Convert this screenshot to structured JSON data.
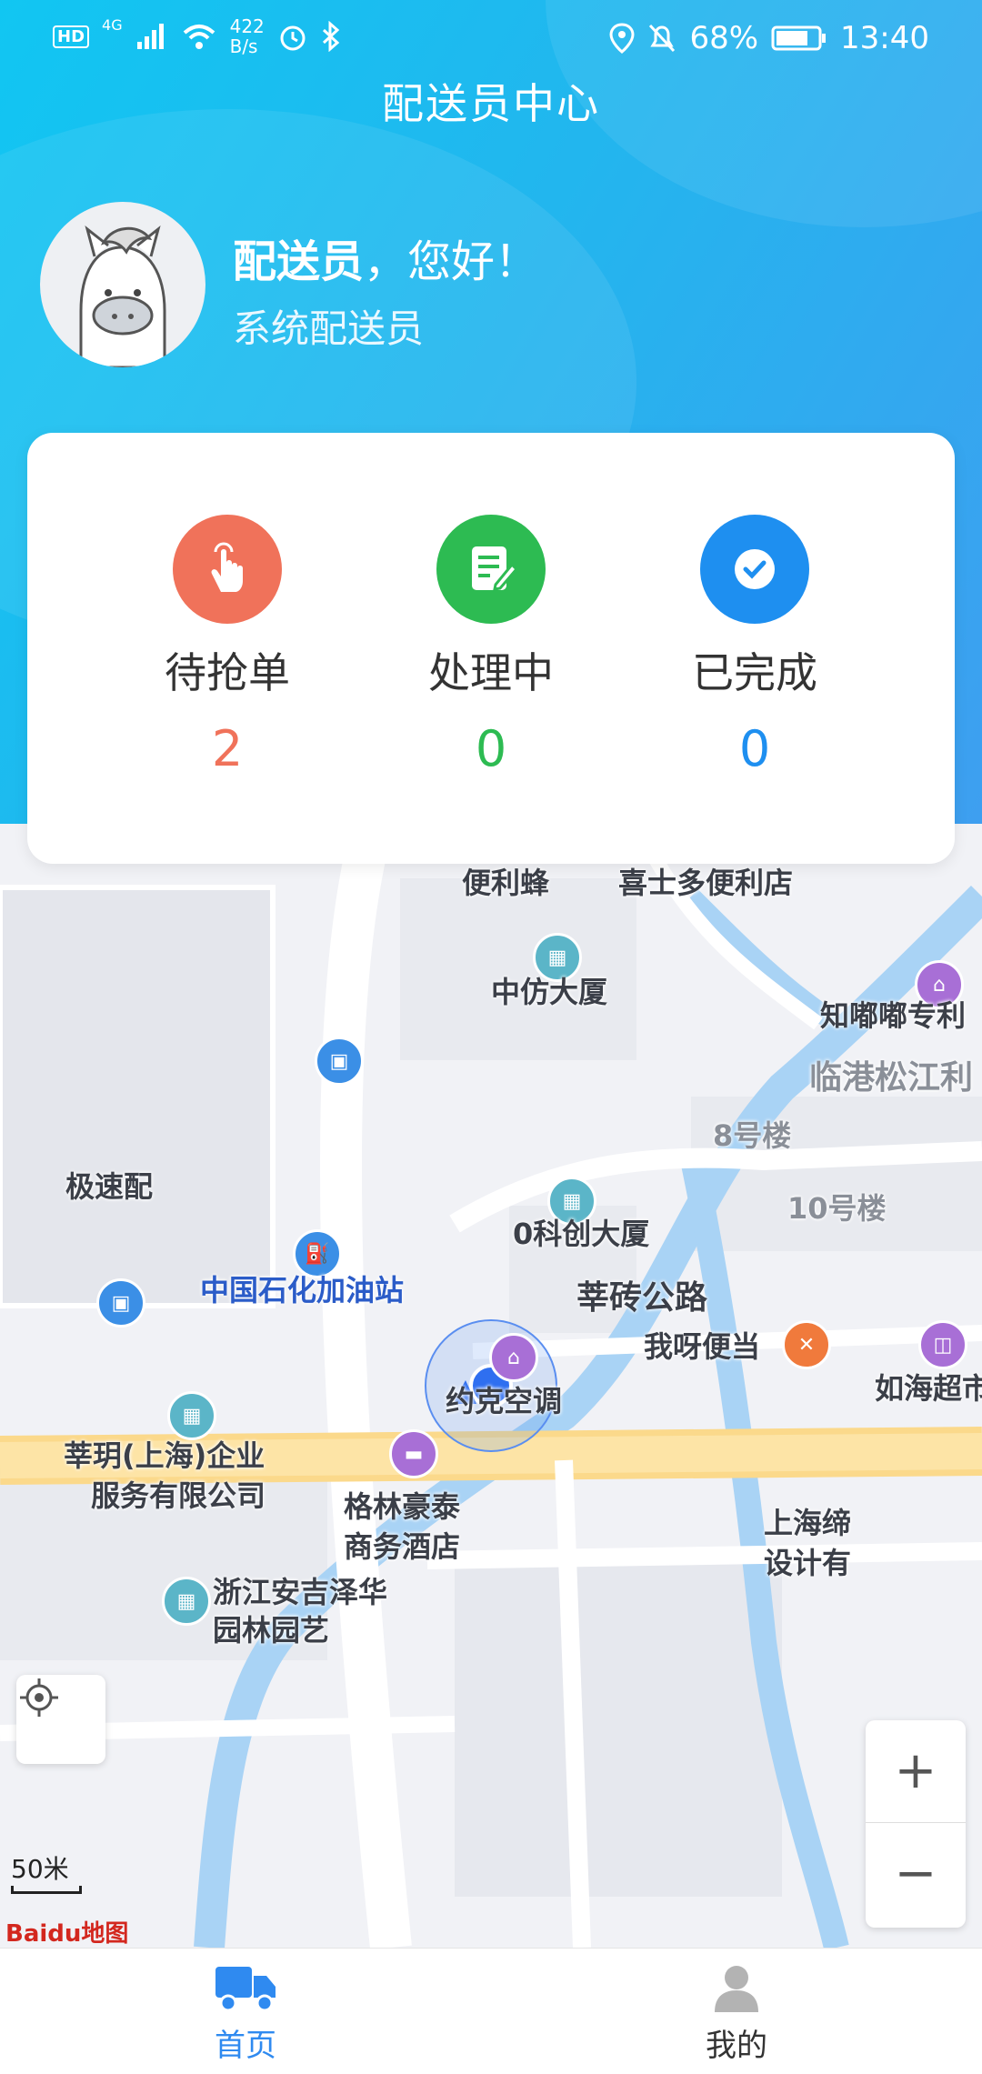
{
  "status_bar": {
    "hd": "HD",
    "network": "4G",
    "speed_value": "422",
    "speed_unit": "B/s",
    "battery": "68%",
    "time": "13:40"
  },
  "header": {
    "title": "配送员中心",
    "user_name": "配送员",
    "greeting_suffix": "，您好！",
    "role": "系统配送员"
  },
  "stats": [
    {
      "label": "待抢单",
      "count": "2",
      "color": "#f0725a"
    },
    {
      "label": "处理中",
      "count": "0",
      "color": "#2dbb52"
    },
    {
      "label": "已完成",
      "count": "0",
      "color": "#1e8ff0"
    }
  ],
  "map": {
    "labels": {
      "bianlifeng": "便利蜂",
      "xishiduo": "喜士多便利店",
      "zhongfang": "中仿大厦",
      "zhidudu": "知嘟嘟专利",
      "lingang": "临港松江利",
      "bld8": "8号楼",
      "jisupei": "极速配",
      "bld10": "10号楼",
      "kechuang": "0科创大厦",
      "sinopec": "中国石化加油站",
      "xinzhuan": "莘砖公路",
      "woyabiandang": "我呀便当",
      "rumgai": "如海超市",
      "yueke": "约克空调",
      "company1a": "莘玥(上海)企业",
      "company1b": "服务有限公司",
      "gelin_a": "格林豪泰",
      "gelin_b": "商务酒店",
      "shanghaiti_a": "上海缔",
      "shanghaiti_b": "设计有",
      "zhejiang_a": "浙江安吉泽华",
      "zhejiang_b": "园林园艺",
      "scale": "50米",
      "logo": "Baidu地图"
    },
    "zoom_in": "+",
    "zoom_out": "−"
  },
  "nav": {
    "home": "首页",
    "mine": "我的",
    "active_color": "#2f8af0"
  }
}
